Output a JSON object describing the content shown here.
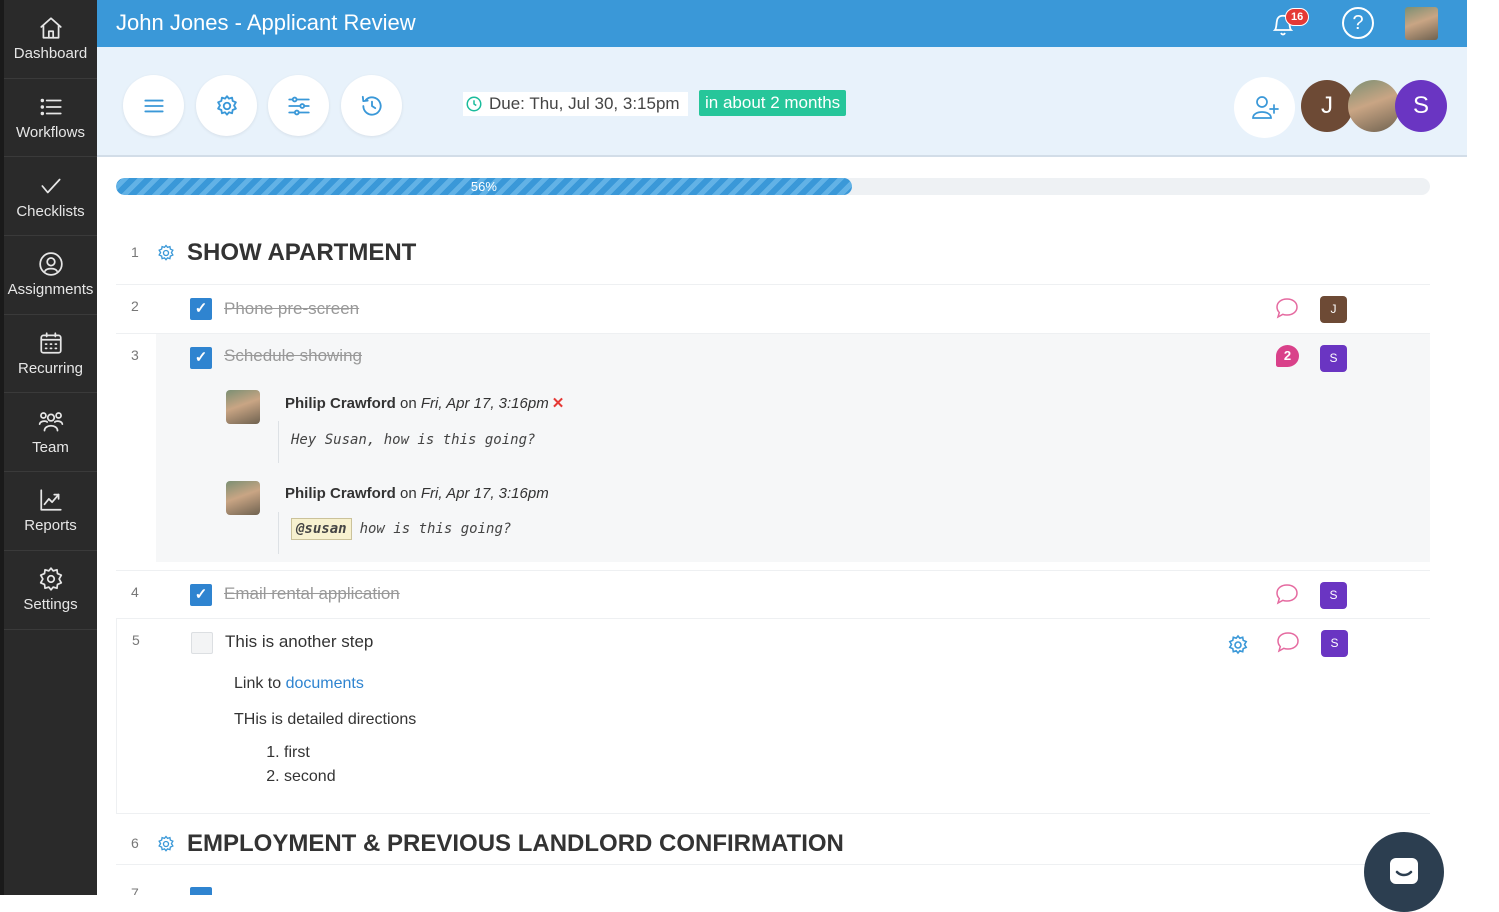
{
  "sidebar": {
    "items": [
      {
        "label": "Dashboard",
        "icon": "home-icon"
      },
      {
        "label": "Workflows",
        "icon": "list-icon"
      },
      {
        "label": "Checklists",
        "icon": "checkmark-icon"
      },
      {
        "label": "Assignments",
        "icon": "user-circle-icon"
      },
      {
        "label": "Recurring",
        "icon": "calendar-icon"
      },
      {
        "label": "Team",
        "icon": "team-icon"
      },
      {
        "label": "Reports",
        "icon": "chart-icon"
      },
      {
        "label": "Settings",
        "icon": "gear-icon"
      }
    ]
  },
  "header": {
    "title": "John Jones - Applicant Review",
    "notification_count": "16",
    "help_label": "?"
  },
  "toolbar": {
    "due_label": "Due: Thu, Jul 30, 3:15pm",
    "due_relative": "in about 2 months",
    "members": [
      {
        "initial": "J",
        "color": "#6d4a35"
      },
      {
        "initial": "",
        "color": "#8a8f6e"
      },
      {
        "initial": "S",
        "color": "#6a35c2"
      }
    ]
  },
  "progress": {
    "label": "56%",
    "value": 0.56
  },
  "checklist": {
    "section1": {
      "num": "1",
      "title": "SHOW APARTMENT"
    },
    "tasks": [
      {
        "num": "2",
        "label": "Phone pre-screen",
        "done": true,
        "assignee": "J",
        "assignee_color": "#6d4a35"
      },
      {
        "num": "3",
        "label": "Schedule showing",
        "done": true,
        "assignee": "S",
        "assignee_color": "#6a35c2",
        "comment_count": "2"
      },
      {
        "num": "4",
        "label": "Email rental application",
        "done": true,
        "assignee": "S",
        "assignee_color": "#6a35c2"
      },
      {
        "num": "5",
        "label": "This is another step",
        "done": false,
        "assignee": "S",
        "assignee_color": "#6a35c2"
      }
    ],
    "comments": [
      {
        "author": "Philip Crawford",
        "on": "on",
        "date": "Fri, Apr 17, 3:16pm",
        "delete": "✕",
        "body": "Hey Susan, how is this going?"
      },
      {
        "author": "Philip Crawford",
        "on": "on",
        "date": "Fri, Apr 17, 3:16pm",
        "mention": "@susan",
        "body": "how is this going?"
      }
    ],
    "details": {
      "link_prefix": "Link to",
      "link_text": "documents",
      "directions": "THis is detailed directions",
      "list": [
        "first",
        "second"
      ]
    },
    "section2": {
      "num": "6",
      "title": "EMPLOYMENT & PREVIOUS LANDLORD CONFIRMATION"
    },
    "next_num": "7"
  }
}
